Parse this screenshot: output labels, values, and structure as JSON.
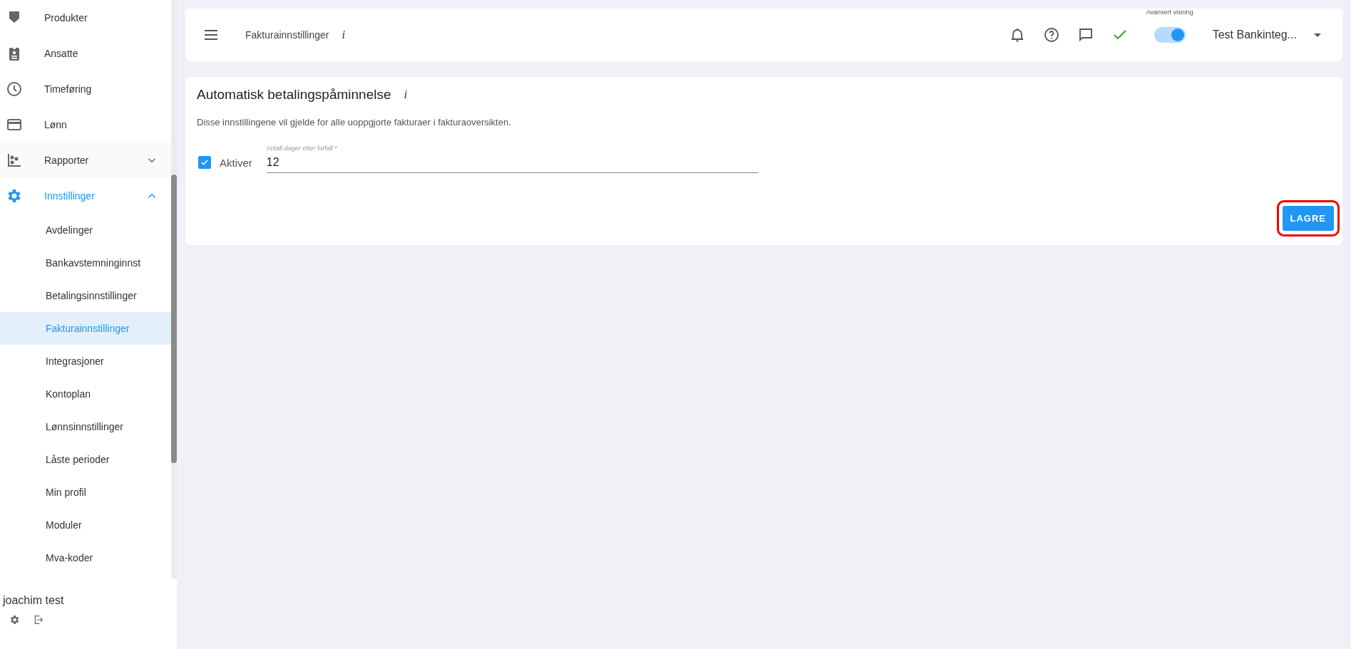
{
  "sidebar": {
    "items": [
      {
        "label": "Produkter",
        "selected": false
      },
      {
        "label": "Ansatte",
        "selected": false
      },
      {
        "label": "Timeføring",
        "selected": false
      },
      {
        "label": "Lønn",
        "selected": false
      },
      {
        "label": "Rapporter",
        "selected": false,
        "expanded": false
      },
      {
        "label": "Innstillinger",
        "selected": true,
        "expanded": true,
        "children": [
          {
            "label": "Avdelinger",
            "selected": false
          },
          {
            "label": "Bankavstemninginnst",
            "selected": false
          },
          {
            "label": "Betalingsinnstillinger",
            "selected": false
          },
          {
            "label": "Fakturainnstillinger",
            "selected": true
          },
          {
            "label": "Integrasjoner",
            "selected": false
          },
          {
            "label": "Kontoplan",
            "selected": false
          },
          {
            "label": "Lønnsinnstillinger",
            "selected": false
          },
          {
            "label": "Låste perioder",
            "selected": false
          },
          {
            "label": "Min profil",
            "selected": false
          },
          {
            "label": "Moduler",
            "selected": false
          },
          {
            "label": "Mva-koder",
            "selected": false
          }
        ]
      }
    ],
    "user": "joachim test"
  },
  "header": {
    "title": "Fakturainnstillinger",
    "info": "i",
    "advanced_view": {
      "label": "Avansert visning",
      "on": true
    },
    "company": "Test Bankinteg..."
  },
  "card": {
    "title": "Automatisk betalingspåminnelse",
    "info": "i",
    "description": "Disse innstillingene vil gjelde for alle uoppgjorte fakturaer i fakturaoversikten.",
    "enable": {
      "label": "Aktiver",
      "checked": true
    },
    "days_field": {
      "label": "Antall dager etter forfall *",
      "value": "12"
    },
    "save_button": {
      "label": "LAGRE",
      "highlighted": true
    }
  }
}
